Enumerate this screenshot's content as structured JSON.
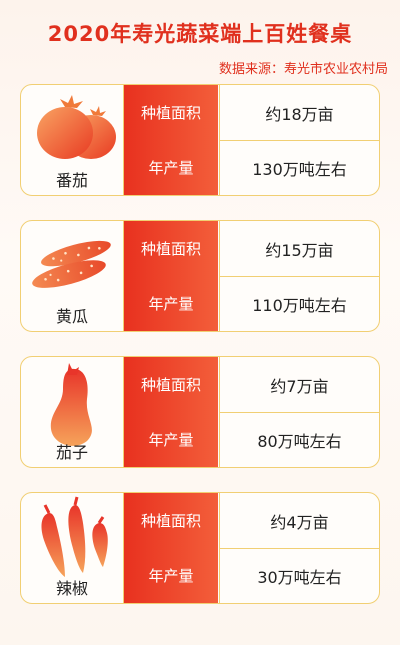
{
  "title": "2020年寿光蔬菜端上百姓餐桌",
  "source": "数据来源：寿光市农业农村局",
  "items": [
    {
      "name": "番茄",
      "icon": "tomato-icon",
      "area_label": "种植面积",
      "area_value": "约18万亩",
      "output_label": "年产量",
      "output_value": "130万吨左右"
    },
    {
      "name": "黄瓜",
      "icon": "cucumber-icon",
      "area_label": "种植面积",
      "area_value": "约15万亩",
      "output_label": "年产量",
      "output_value": "110万吨左右"
    },
    {
      "name": "茄子",
      "icon": "eggplant-icon",
      "area_label": "种植面积",
      "area_value": "约7万亩",
      "output_label": "年产量",
      "output_value": "80万吨左右"
    },
    {
      "name": "辣椒",
      "icon": "pepper-icon",
      "area_label": "种植面积",
      "area_value": "约4万亩",
      "output_label": "年产量",
      "output_value": "30万吨左右"
    }
  ],
  "colors": {
    "accent": "#e0301e",
    "border": "#f1cf73"
  }
}
